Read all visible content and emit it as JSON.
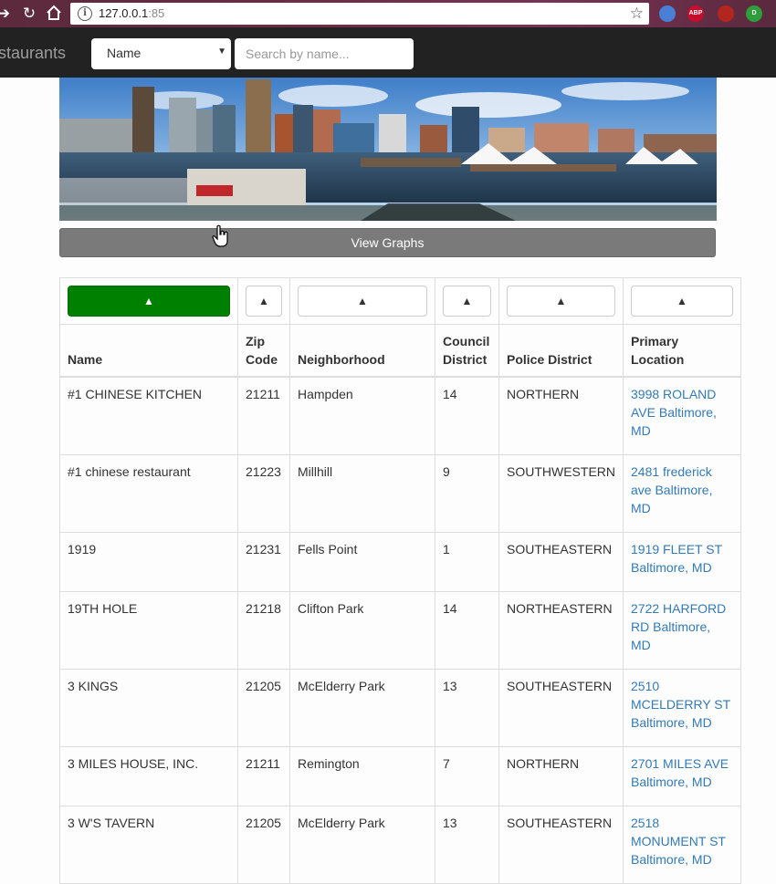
{
  "browser": {
    "url_host": "127.0.0.1",
    "url_port": ":85",
    "extensions": [
      {
        "name": "google-translate-icon",
        "color": "#4a7fd6",
        "label": ""
      },
      {
        "name": "adblock-plus-icon",
        "color": "#c70d2c",
        "label": "ABP"
      },
      {
        "name": "ublock-icon",
        "color": "#b3261e",
        "label": ""
      },
      {
        "name": "extension-green-icon",
        "color": "#2e9d3a",
        "label": "D"
      }
    ]
  },
  "navbar": {
    "brand": "staurants",
    "filter_selected": "Name",
    "search_placeholder": "Search by name..."
  },
  "banner": {
    "alt": ""
  },
  "view_graphs_label": "View Graphs",
  "sort_icon": "▲",
  "columns": [
    {
      "key": "name",
      "label": "Name"
    },
    {
      "key": "zip",
      "label": "Zip Code"
    },
    {
      "key": "neighborhood",
      "label": "Neighborhood"
    },
    {
      "key": "council",
      "label": "Council District"
    },
    {
      "key": "police",
      "label": "Police District"
    },
    {
      "key": "location",
      "label": "Primary Location"
    }
  ],
  "rows": [
    {
      "name": "#1 CHINESE KITCHEN",
      "zip": "21211",
      "neighborhood": "Hampden",
      "council": "14",
      "police": "NORTHERN",
      "location": "3998 ROLAND AVE Baltimore, MD"
    },
    {
      "name": "#1 chinese restaurant",
      "zip": "21223",
      "neighborhood": "Millhill",
      "council": "9",
      "police": "SOUTHWESTERN",
      "location": "2481 frederick ave Baltimore, MD"
    },
    {
      "name": "1919",
      "zip": "21231",
      "neighborhood": "Fells Point",
      "council": "1",
      "police": "SOUTHEASTERN",
      "location": "1919 FLEET ST Baltimore, MD"
    },
    {
      "name": "19TH HOLE",
      "zip": "21218",
      "neighborhood": "Clifton Park",
      "council": "14",
      "police": "NORTHEASTERN",
      "location": "2722 HARFORD RD Baltimore, MD"
    },
    {
      "name": "3 KINGS",
      "zip": "21205",
      "neighborhood": "McElderry Park",
      "council": "13",
      "police": "SOUTHEASTERN",
      "location": "2510 MCELDERRY ST Baltimore, MD"
    },
    {
      "name": "3 MILES HOUSE, INC.",
      "zip": "21211",
      "neighborhood": "Remington",
      "council": "7",
      "police": "NORTHERN",
      "location": "2701 MILES AVE Baltimore, MD"
    },
    {
      "name": "3 W'S TAVERN",
      "zip": "21205",
      "neighborhood": "McElderry Park",
      "council": "13",
      "police": "SOUTHEASTERN",
      "location": "2518 MONUMENT ST Baltimore, MD"
    }
  ]
}
